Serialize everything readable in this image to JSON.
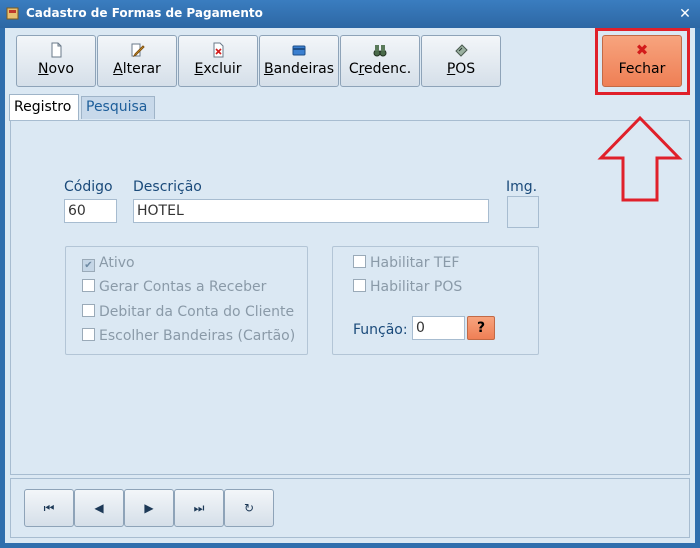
{
  "window": {
    "title": "Cadastro de Formas de Pagamento"
  },
  "toolbar": {
    "buttons": [
      {
        "label": "Novo",
        "underline": "N",
        "rest": "ovo",
        "icon": "new-document-icon"
      },
      {
        "label": "Alterar",
        "underline": "A",
        "rest": "lterar",
        "icon": "edit-pencil-icon"
      },
      {
        "label": "Excluir",
        "underline": "E",
        "rest": "xcluir",
        "icon": "delete-document-icon"
      },
      {
        "label": "Bandeiras",
        "underline": "B",
        "rest": "andeiras",
        "icon": "card-icon"
      },
      {
        "label": "Credenc.",
        "underline": "r",
        "pre": "C",
        "rest": "edenc.",
        "icon": "binoculars-icon"
      },
      {
        "label": "POS",
        "underline": "P",
        "rest": "OS",
        "icon": "pos-terminal-icon"
      }
    ],
    "close": {
      "label": "Fechar",
      "underline": "F",
      "rest": "echar",
      "icon": "close-x-icon"
    }
  },
  "tabs": [
    {
      "label": "Registro",
      "active": true
    },
    {
      "label": "Pesquisa",
      "active": false
    }
  ],
  "form": {
    "codigo_label": "Código",
    "codigo_value": "60",
    "descricao_label": "Descrição",
    "descricao_value": "HOTEL",
    "img_label": "Img.",
    "left_checks": [
      {
        "label": "Ativo",
        "checked": true
      },
      {
        "label": "Gerar Contas a Receber",
        "checked": false
      },
      {
        "label": "Debitar da Conta do Cliente",
        "checked": false
      },
      {
        "label": "Escolher Bandeiras (Cartão)",
        "checked": false
      }
    ],
    "right_checks": [
      {
        "label": "Habilitar TEF",
        "checked": false
      },
      {
        "label": "Habilitar POS",
        "checked": false
      }
    ],
    "funcao_label": "Função:",
    "funcao_value": "0",
    "help_label": "?"
  },
  "nav": {
    "first": "⏮",
    "prev": "◀",
    "next": "▶",
    "last": "⏭",
    "refresh": "↻"
  }
}
